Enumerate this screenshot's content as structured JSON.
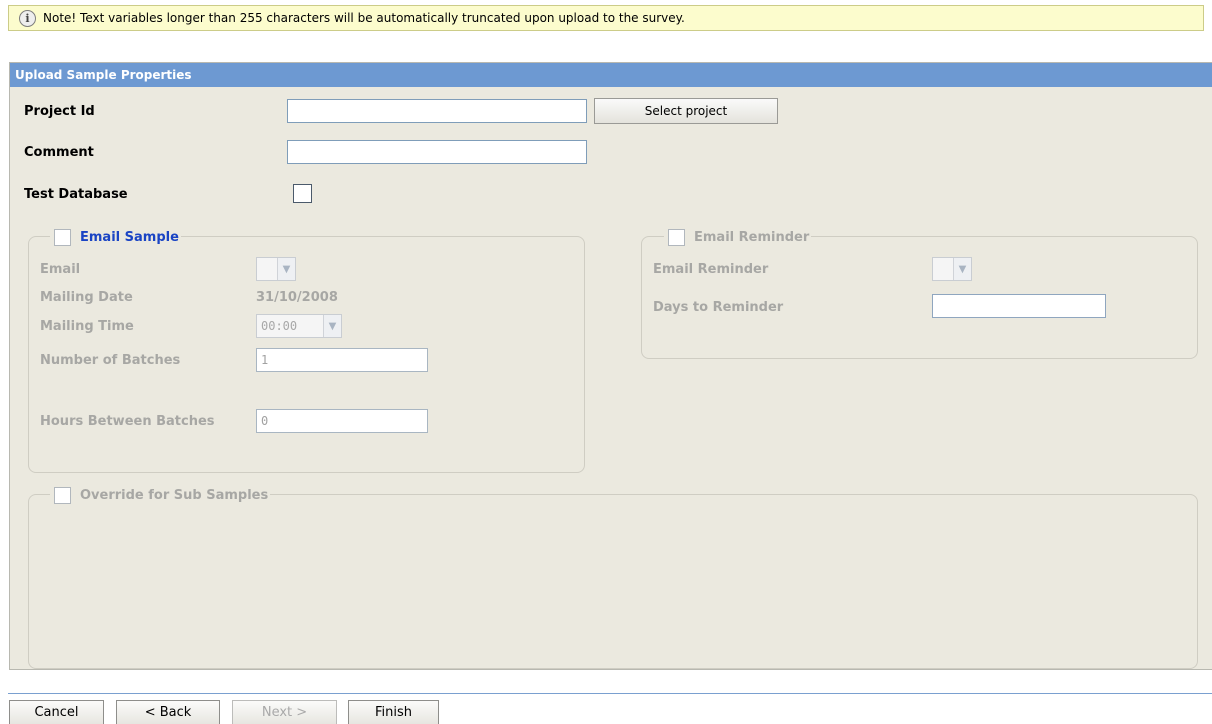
{
  "note": {
    "icon": "info-icon",
    "text": "Note! Text variables longer than 255 characters will be automatically truncated upon upload to the survey."
  },
  "panel": {
    "title": "Upload Sample Properties",
    "project_id": {
      "label": "Project Id",
      "value": "",
      "select_button": "Select project"
    },
    "comment": {
      "label": "Comment",
      "value": ""
    },
    "test_database": {
      "label": "Test Database",
      "checked": false
    }
  },
  "email_sample": {
    "legend": "Email Sample",
    "checked": false,
    "email": {
      "label": "Email",
      "value": ""
    },
    "mailing_date": {
      "label": "Mailing Date",
      "value": "31/10/2008"
    },
    "mailing_time": {
      "label": "Mailing Time",
      "value": "00:00"
    },
    "number_of_batches": {
      "label": "Number of Batches",
      "value": "1"
    },
    "hours_between_batches": {
      "label": "Hours Between Batches",
      "value": "0"
    }
  },
  "email_reminder": {
    "legend": "Email Reminder",
    "checked": false,
    "email_reminder": {
      "label": "Email Reminder",
      "value": ""
    },
    "days_to_reminder": {
      "label": "Days to Reminder",
      "value": ""
    }
  },
  "override": {
    "legend": "Override for Sub Samples",
    "checked": false
  },
  "footer": {
    "cancel": "Cancel",
    "back": "< Back",
    "next": "Next >",
    "finish": "Finish"
  },
  "colors": {
    "header_bg": "#6d99d2",
    "panel_bg": "#ebe9df",
    "note_bg": "#fcfccd",
    "legend_blue": "#1a44c4",
    "disabled_text": "#a7a7a4"
  }
}
